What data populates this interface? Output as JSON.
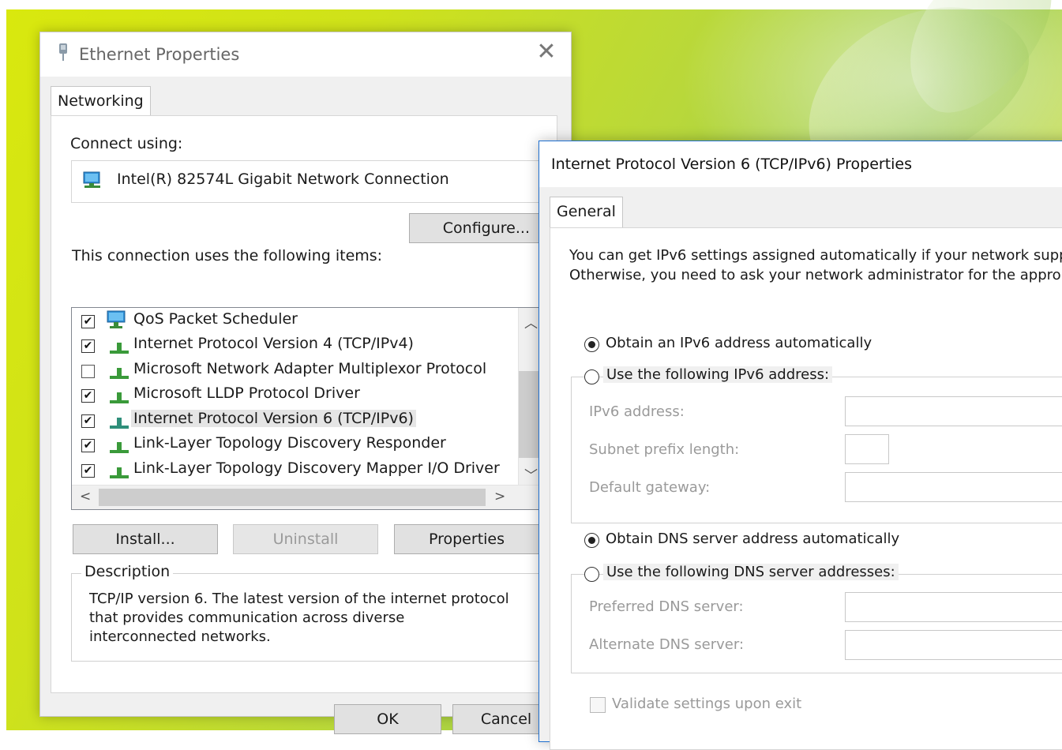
{
  "ethernet_dialog": {
    "title": "Ethernet Properties",
    "close_glyph": "✕",
    "tab": "Networking",
    "connect_using_label": "Connect using:",
    "adapter_name": "Intel(R) 82574L Gigabit Network Connection",
    "configure_label": "Configure...",
    "items_label": "This connection uses the following items:",
    "items": [
      {
        "label": "QoS Packet Scheduler",
        "checked": true,
        "icon": "qos-monitor-icon"
      },
      {
        "label": "Internet Protocol Version 4 (TCP/IPv4)",
        "checked": true,
        "icon": "protocol-icon"
      },
      {
        "label": "Microsoft Network Adapter Multiplexor Protocol",
        "checked": false,
        "icon": "protocol-icon"
      },
      {
        "label": "Microsoft LLDP Protocol Driver",
        "checked": true,
        "icon": "protocol-icon"
      },
      {
        "label": "Internet Protocol Version 6 (TCP/IPv6)",
        "checked": true,
        "icon": "protocol-icon",
        "selected": true
      },
      {
        "label": "Link-Layer Topology Discovery Responder",
        "checked": true,
        "icon": "protocol-icon"
      },
      {
        "label": "Link-Layer Topology Discovery Mapper I/O Driver",
        "checked": true,
        "icon": "protocol-icon"
      }
    ],
    "install_label": "Install...",
    "uninstall_label": "Uninstall",
    "properties_label": "Properties",
    "description_title": "Description",
    "description_text": "TCP/IP version 6. The latest version of the internet protocol that provides communication across diverse interconnected networks.",
    "ok_label": "OK",
    "cancel_label": "Cancel"
  },
  "ipv6_dialog": {
    "title": "Internet Protocol Version 6 (TCP/IPv6) Properties",
    "tab": "General",
    "intro_line1": "You can get IPv6 settings assigned automatically if your network supp",
    "intro_line2": "Otherwise, you need to ask your network administrator for the approp",
    "obtain_ip_auto": "Obtain an IPv6 address automatically",
    "use_following_ip": "Use the following IPv6 address:",
    "ipv6_address_label": "IPv6 address:",
    "subnet_prefix_label": "Subnet prefix length:",
    "default_gateway_label": "Default gateway:",
    "obtain_dns_auto": "Obtain DNS server address automatically",
    "use_following_dns": "Use the following DNS server addresses:",
    "preferred_dns_label": "Preferred DNS server:",
    "alternate_dns_label": "Alternate DNS server:",
    "validate_label": "Validate settings upon exit",
    "ip_mode": "automatic",
    "dns_mode": "automatic"
  },
  "colors": {
    "accent_border": "#1e6fd0",
    "desktop_green": "#cfe21a"
  }
}
